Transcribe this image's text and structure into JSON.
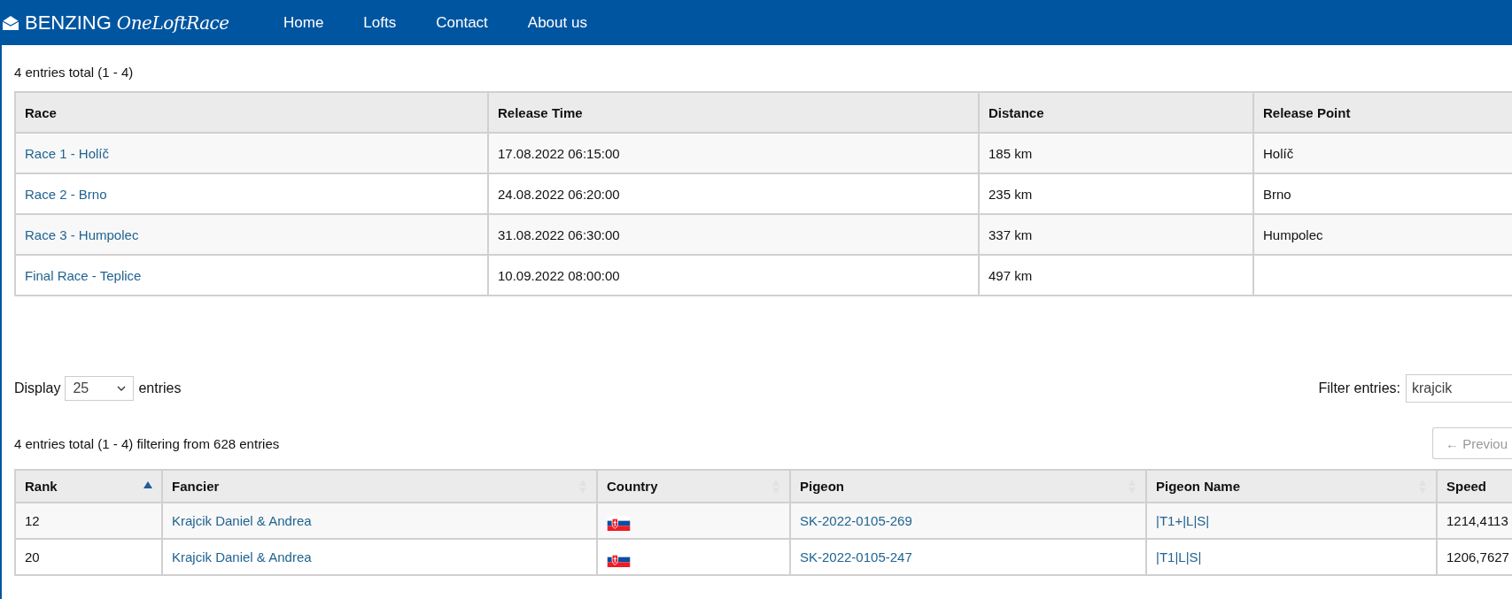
{
  "navbar": {
    "brand": {
      "name": "BENZING",
      "tagline": "OneLoftRace"
    },
    "links": [
      {
        "label": "Home"
      },
      {
        "label": "Lofts"
      },
      {
        "label": "Contact"
      },
      {
        "label": "About us"
      }
    ]
  },
  "races": {
    "summary": "4 entries total (1 - 4)",
    "columns": [
      "Race",
      "Release Time",
      "Distance",
      "Release Point"
    ],
    "rows": [
      {
        "race": "Race 1 - Holíč",
        "release_time": "17.08.2022 06:15:00",
        "distance": "185 km",
        "release_point": "Holíč"
      },
      {
        "race": "Race 2 - Brno",
        "release_time": "24.08.2022 06:20:00",
        "distance": "235 km",
        "release_point": "Brno"
      },
      {
        "race": "Race 3 - Humpolec",
        "release_time": "31.08.2022 06:30:00",
        "distance": "337 km",
        "release_point": "Humpolec"
      },
      {
        "race": "Final Race - Teplice",
        "release_time": "10.09.2022 08:00:00",
        "distance": "497 km",
        "release_point": ""
      }
    ]
  },
  "results": {
    "display_label": "Display",
    "page_size": "25",
    "entries_label": "entries",
    "filter": {
      "label": "Filter entries:",
      "value": "krajcik"
    },
    "summary": "4 entries total (1 - 4) filtering from 628 entries",
    "previous_button": {
      "label": "← Previou",
      "disabled": true
    },
    "columns": [
      {
        "label": "Rank",
        "sorted": true
      },
      {
        "label": "Fancier",
        "sorted": false
      },
      {
        "label": "Country",
        "sorted": false
      },
      {
        "label": "Pigeon",
        "sorted": false
      },
      {
        "label": "Pigeon Name",
        "sorted": false
      },
      {
        "label": "Speed"
      }
    ],
    "rows": [
      {
        "rank": "12",
        "fancier": "Krajcik Daniel & Andrea",
        "pigeon": "SK-2022-0105-269",
        "pigeon_name": "|T1+|L|S|",
        "speed": "1214,4113"
      },
      {
        "rank": "20",
        "fancier": "Krajcik Daniel & Andrea",
        "pigeon": "SK-2022-0105-247",
        "pigeon_name": "|T1|L|S|",
        "speed": "1206,7627"
      }
    ]
  }
}
